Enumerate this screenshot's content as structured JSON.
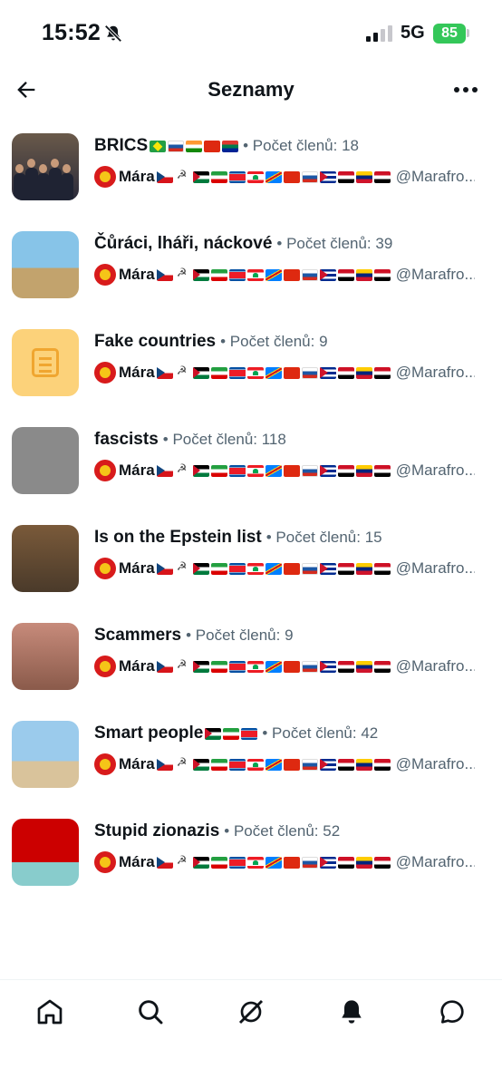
{
  "status_bar": {
    "time": "15:52",
    "network": "5G",
    "battery": "85"
  },
  "header": {
    "title": "Seznamy"
  },
  "lists": [
    {
      "title": "BRICS",
      "title_flags": [
        "br",
        "ru",
        "in",
        "cn",
        "za"
      ],
      "meta": "• Počet členů: 18",
      "owner": "Mára",
      "handle": "@Marafro...",
      "avatar": "brics"
    },
    {
      "title": "Čůráci, lháři, náckové",
      "title_flags": [],
      "meta": "• Počet členů: 39",
      "owner": "Mára",
      "handle": "@Marafro...",
      "avatar": "curaci"
    },
    {
      "title": "Fake countries",
      "title_flags": [],
      "meta": "• Počet členů: 9",
      "owner": "Mára",
      "handle": "@Marafro...",
      "avatar": "fake"
    },
    {
      "title": "fascists",
      "title_flags": [],
      "meta": "• Počet členů: 118",
      "owner": "Mára",
      "handle": "@Marafro...",
      "avatar": "fascists"
    },
    {
      "title": "Is on the Epstein list",
      "title_flags": [],
      "meta": "• Počet členů: 15",
      "owner": "Mára",
      "handle": "@Marafro...",
      "avatar": "epstein"
    },
    {
      "title": "Scammers",
      "title_flags": [],
      "meta": "• Počet členů: 9",
      "owner": "Mára",
      "handle": "@Marafro...",
      "avatar": "scam"
    },
    {
      "title": "Smart people",
      "title_flags": [
        "ps",
        "ir",
        "kp"
      ],
      "meta": "• Počet členů: 42",
      "owner": "Mára",
      "handle": "@Marafro...",
      "avatar": "smart"
    },
    {
      "title": "Stupid zionazis",
      "title_flags": [],
      "meta": "• Počet členů: 52",
      "owner": "Mára",
      "handle": "@Marafro...",
      "avatar": "zion"
    }
  ],
  "owner_flags": [
    "cz",
    "ham",
    "ps",
    "ir",
    "kp",
    "lb",
    "cd",
    "cn",
    "ru",
    "cu",
    "ye",
    "ve",
    "eg"
  ],
  "bottom_nav": [
    "home-icon",
    "search-icon",
    "grok-icon",
    "notifications-icon",
    "messages-icon"
  ]
}
